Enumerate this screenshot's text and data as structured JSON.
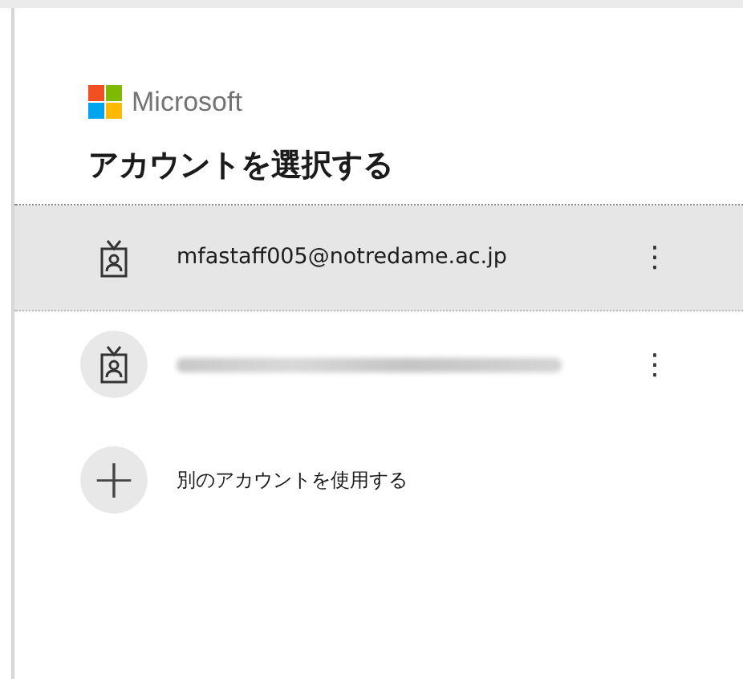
{
  "brand": "Microsoft",
  "title": "アカウントを選択する",
  "accounts": [
    {
      "kind": "email",
      "email": "mfastaff005@notredame.ac.jp",
      "selected": true,
      "more": "⋮"
    },
    {
      "kind": "redacted",
      "selected": false,
      "more": "⋮"
    }
  ],
  "add_account": {
    "icon": "+",
    "label": "別のアカウントを使用する"
  }
}
